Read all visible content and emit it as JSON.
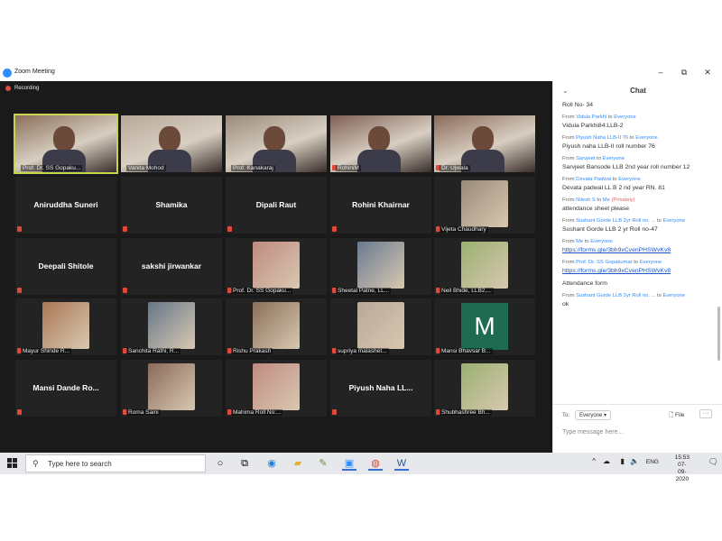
{
  "window": {
    "title": "Zoom Meeting",
    "controls": {
      "minimize": "–",
      "maximize": "⧉",
      "close": "✕"
    }
  },
  "meeting": {
    "recording_label": "Recording",
    "tiles": [
      {
        "type": "video",
        "label": "Prof. Dr. SS Gopaku...",
        "active": true,
        "muted": false
      },
      {
        "type": "video",
        "label": "Vanita Mohod",
        "active": false,
        "muted": false
      },
      {
        "type": "video",
        "label": "Prof. Kanakaraj",
        "active": false,
        "muted": false
      },
      {
        "type": "video",
        "label": "RohiniM",
        "active": false,
        "muted": true
      },
      {
        "type": "video",
        "label": "Dr. Ujwala",
        "active": false,
        "muted": true
      },
      {
        "type": "name",
        "name": "Aniruddha Suneri",
        "muted": true
      },
      {
        "type": "name",
        "name": "Shamika",
        "muted": true
      },
      {
        "type": "name",
        "name": "Dipali Raut",
        "muted": true
      },
      {
        "type": "name",
        "name": "Rohini Khairnar",
        "muted": true
      },
      {
        "type": "photo",
        "label": "Vijeta Chaudhary",
        "muted": true
      },
      {
        "type": "name",
        "name": "Deepali Shitole",
        "muted": true
      },
      {
        "type": "name",
        "name": "sakshi jirwankar",
        "muted": true
      },
      {
        "type": "photo",
        "label": "Prof. Dr. SS Gopaku...",
        "muted": true
      },
      {
        "type": "photo",
        "label": "Sheetal Patne, LL...",
        "muted": true
      },
      {
        "type": "photo",
        "label": "Neil Bhide, LLB2,...",
        "muted": true
      },
      {
        "type": "photo",
        "label": "Mayur Shinde R...",
        "muted": true
      },
      {
        "type": "photo",
        "label": "Sanchita Rathi, R...",
        "muted": true
      },
      {
        "type": "photo",
        "label": "Rishu Prakash",
        "muted": true
      },
      {
        "type": "photo",
        "label": "supriya malashet...",
        "muted": true
      },
      {
        "type": "letter",
        "letter": "M",
        "label": "Mansi Bhavsar B...",
        "muted": true
      },
      {
        "type": "name",
        "name": "Mansi Dande Ro...",
        "muted": true
      },
      {
        "type": "photo",
        "label": "Roma Saini",
        "muted": true
      },
      {
        "type": "photo",
        "label": "Mahima Roll No:...",
        "muted": true
      },
      {
        "type": "name",
        "name": "Piyush Naha LL...",
        "muted": true
      },
      {
        "type": "photo",
        "label": "Shubhashree Bh...",
        "muted": true
      }
    ]
  },
  "chat": {
    "title": "Chat",
    "messages": [
      {
        "from": "",
        "to": "",
        "body": "Roll No- 34"
      },
      {
        "from": "Vidula Parkhi",
        "to": "Everyone",
        "body": "Vidula Parkhi84:LLB-2"
      },
      {
        "from": "Piyush Naha LLB-II  76",
        "to": "Everyone",
        "body": "Piyush naha LLB-II roll number 76"
      },
      {
        "from": "Sarvjeet",
        "to": "Everyone",
        "body": "Sarvjeet Bansode LLB 2nd year roll number 12"
      },
      {
        "from": "Devata Padwal",
        "to": "Everyone",
        "body": "Devata padwal LL B 2 nd year RN. 81"
      },
      {
        "from": "Nilesh S",
        "to": "Me",
        "private": "(Privately)",
        "body": "attendance sheet please"
      },
      {
        "from": "Sushant Gorde LLB 2yr Roll no. ...",
        "to": "Everyone",
        "body": "Sushant Gorde LLB 2 yr Roll no-47"
      },
      {
        "from": "Me",
        "to": "Everyone",
        "link": "https://forms.gle/3bh9xCvenPHSWvKv8"
      },
      {
        "from": "Prof. Dr. SS Gopakumar",
        "to": "Everyone",
        "link": "https://forms.gle/3bh9xCvenPHSWvKv8"
      },
      {
        "from": "",
        "to": "",
        "body": "Attendance form"
      },
      {
        "from": "Sushant Gorde LLB 2yr Roll no. ...",
        "to": "Everyone",
        "body": "ok"
      }
    ],
    "footer": {
      "to_label": "To:",
      "recipient": "Everyone ▾",
      "file_label": "File",
      "more_label": "···",
      "placeholder": "Type message here..."
    }
  },
  "taskbar": {
    "search_placeholder": "Type here to search",
    "tray": {
      "lang": "ENG",
      "time": "15:53",
      "date": "07-09-2020"
    }
  }
}
